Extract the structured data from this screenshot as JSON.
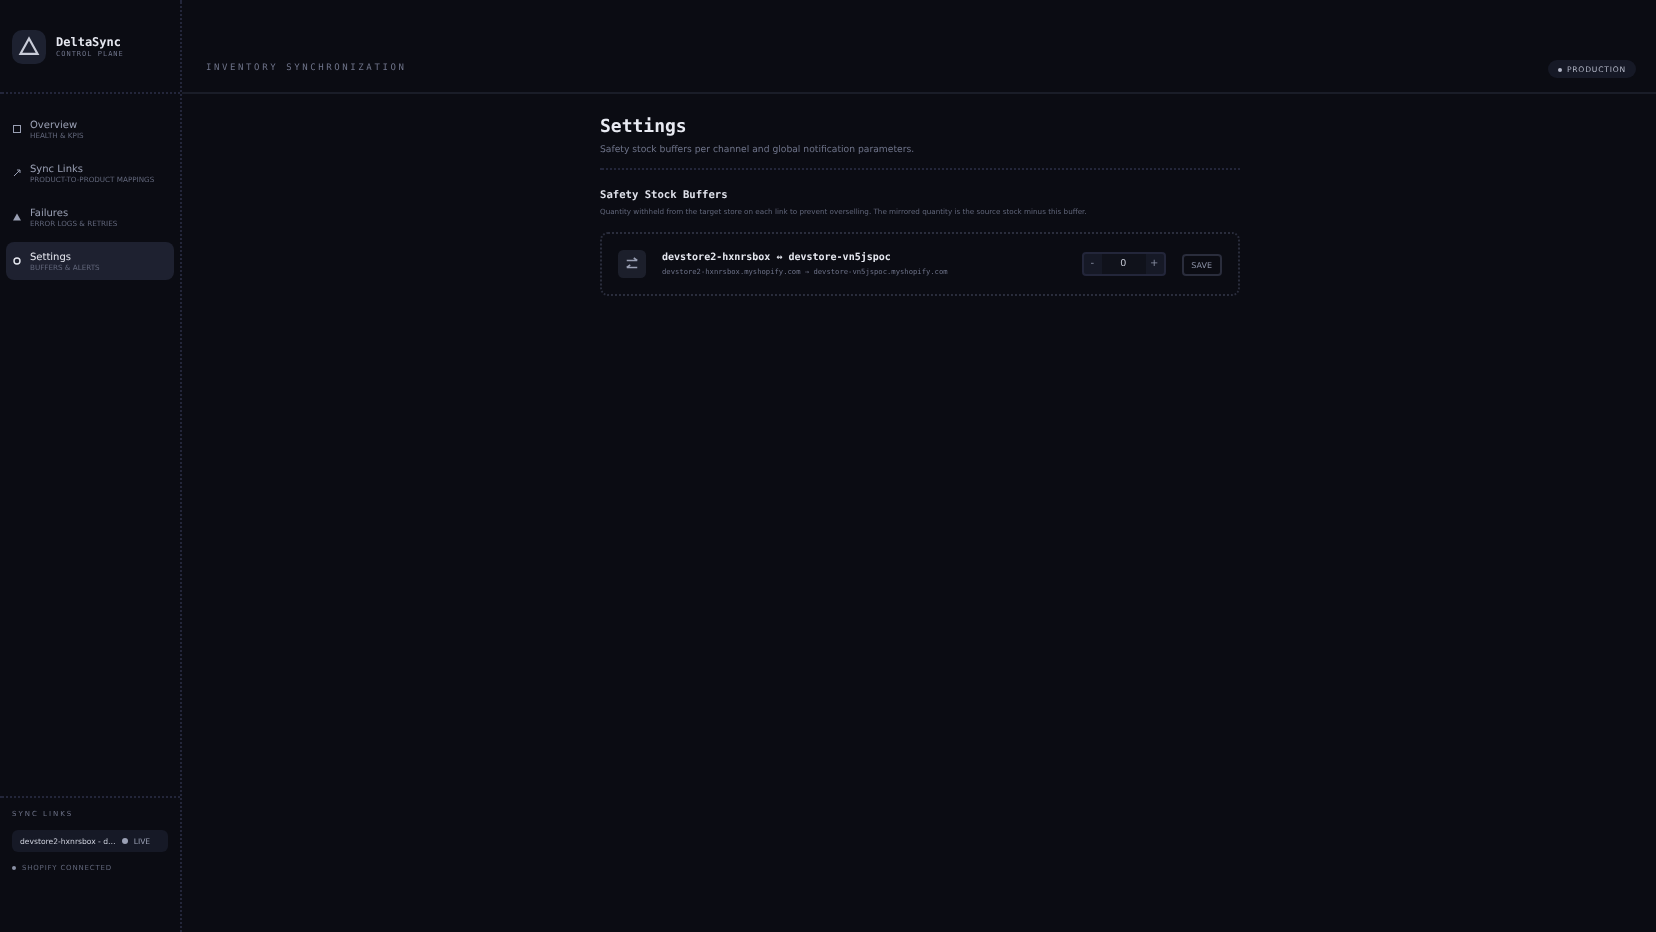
{
  "brand": {
    "name": "DeltaSync",
    "subtitle": "CONTROL PLANE"
  },
  "nav": [
    {
      "label": "Overview",
      "sub": "HEALTH & KPIS",
      "kind": "overview",
      "selected": false
    },
    {
      "label": "Sync Links",
      "sub": "PRODUCT-TO-PRODUCT MAPPINGS",
      "kind": "links",
      "selected": false
    },
    {
      "label": "Failures",
      "sub": "ERROR LOGS & RETRIES",
      "kind": "failures",
      "selected": false
    },
    {
      "label": "Settings",
      "sub": "BUFFERS & ALERTS",
      "kind": "settings",
      "selected": true
    }
  ],
  "sidebar_footer": {
    "heading": "SYNC LINKS",
    "link": {
      "name": "devstore2-hxnrsbox - d…",
      "status": "LIVE"
    },
    "connection": "SHOPIFY CONNECTED"
  },
  "header": {
    "title": "INVENTORY SYNCHRONIZATION",
    "environment": "PRODUCTION"
  },
  "page": {
    "title": "Settings",
    "subtitle": "Safety stock buffers per channel and global notification parameters."
  },
  "section": {
    "title": "Safety Stock Buffers",
    "description": "Quantity withheld from the target store on each link to prevent overselling. The mirrored quantity is the source stock minus this buffer.",
    "links": [
      {
        "name": "devstore2-hxnrsbox ↔ devstore-vn5jspoc",
        "detail": "devstore2-hxnrsbox.myshopify.com → devstore-vn5jspoc.myshopify.com",
        "decrement": "-",
        "value": "0",
        "increment": "+",
        "save": "SAVE"
      }
    ]
  }
}
